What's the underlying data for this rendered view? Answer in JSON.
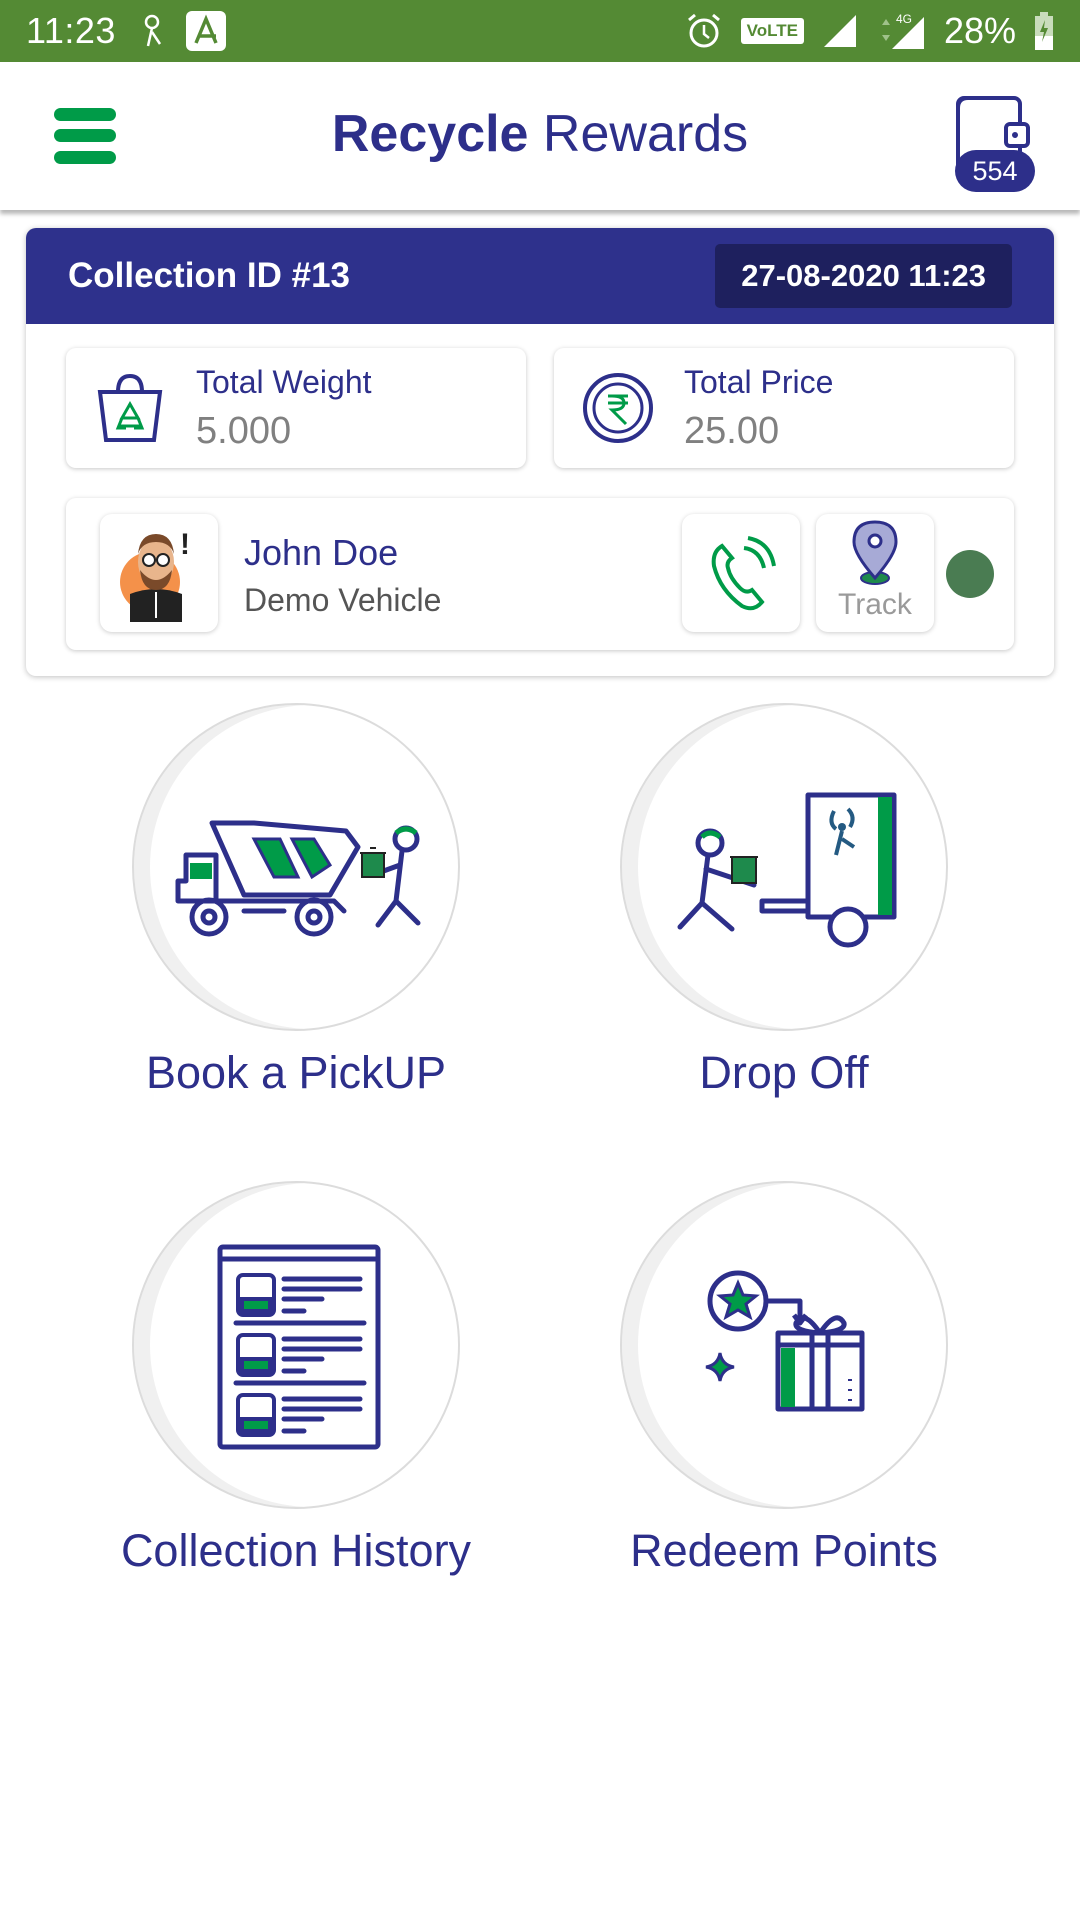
{
  "status_bar": {
    "time": "11:23",
    "network_badge": "VoLTE",
    "network_type": "4G",
    "battery_percent": "28%",
    "icons": [
      "notification-app-icon",
      "app-store-icon",
      "alarm-icon",
      "volte-icon",
      "signal-icon",
      "signal-4g-icon",
      "battery-charging-icon"
    ]
  },
  "app_bar": {
    "title_bold": "Recycle",
    "title_regular": " Rewards",
    "wallet_points": "554"
  },
  "collection": {
    "id_label": "Collection ID #13",
    "datetime": "27-08-2020 11:23",
    "total_weight_label": "Total Weight",
    "total_weight_value": "5.000",
    "total_price_label": "Total Price",
    "total_price_value": "25.00"
  },
  "driver": {
    "name": "John Doe",
    "vehicle": "Demo Vehicle",
    "track_label": "Track",
    "status_color": "#4a7c52"
  },
  "menu": [
    {
      "label": "Book a PickUP",
      "icon": "pickup-truck-icon"
    },
    {
      "label": "Drop Off",
      "icon": "drop-off-icon"
    },
    {
      "label": "Collection History",
      "icon": "history-list-icon"
    },
    {
      "label": "Redeem Points",
      "icon": "gift-redeem-icon"
    }
  ],
  "colors": {
    "status_bar": "#548a34",
    "primary": "#2d2f8a",
    "accent_green": "#009b48"
  }
}
